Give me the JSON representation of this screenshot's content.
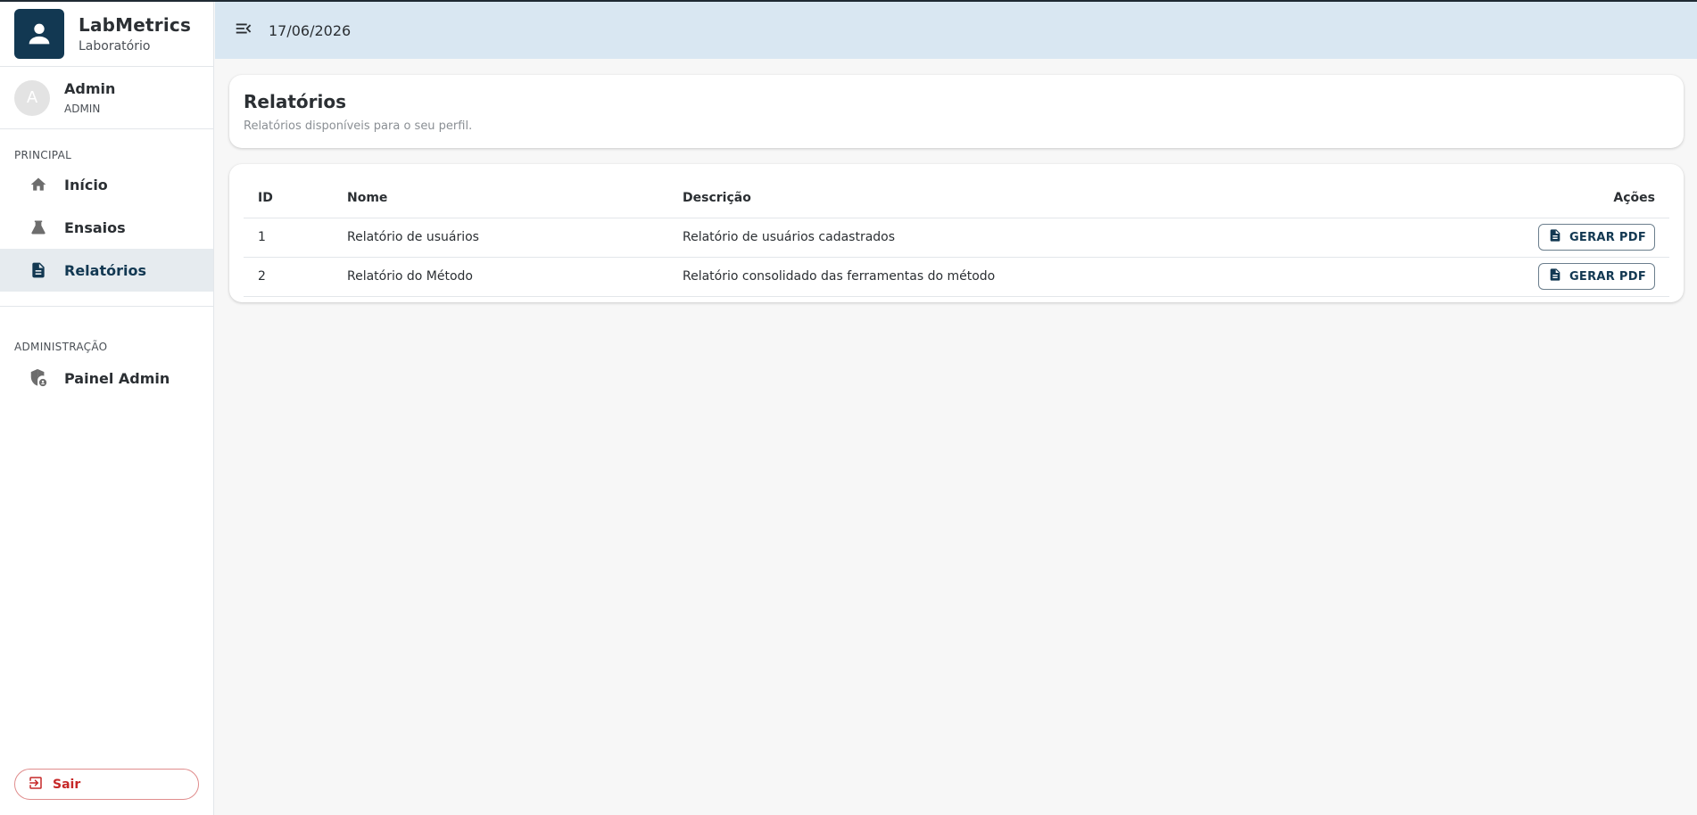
{
  "app": {
    "title": "LabMetrics",
    "subtitle": "Laboratório"
  },
  "user": {
    "initial": "A",
    "name": "Admin",
    "role": "ADMIN"
  },
  "sidebar": {
    "sections": [
      {
        "label": "PRINCIPAL",
        "items": [
          {
            "label": "Início",
            "icon": "home-icon"
          },
          {
            "label": "Ensaios",
            "icon": "flask-icon"
          },
          {
            "label": "Relatórios",
            "icon": "document-icon",
            "active": true
          }
        ]
      },
      {
        "label": "ADMINISTRAÇÃO",
        "items": [
          {
            "label": "Painel Admin",
            "icon": "admin-shield-icon"
          }
        ]
      }
    ],
    "logout_label": "Sair"
  },
  "topbar": {
    "date": "17/06/2026"
  },
  "page": {
    "title": "Relatórios",
    "subtitle": "Relatórios disponíveis para o seu perfil."
  },
  "table": {
    "headers": {
      "id": "ID",
      "name": "Nome",
      "description": "Descrição",
      "actions": "Ações"
    },
    "rows": [
      {
        "id": "1",
        "name": "Relatório de usuários",
        "description": "Relatório de usuários cadastrados",
        "action": "GERAR PDF"
      },
      {
        "id": "2",
        "name": "Relatório do Método",
        "description": "Relatório consolidado das ferramentas do método",
        "action": "GERAR PDF"
      }
    ]
  },
  "colors": {
    "brand": "#123852",
    "topbar_bg": "#d9e7f2",
    "active_item_bg": "#e6ebef",
    "logout": "#c62828"
  }
}
